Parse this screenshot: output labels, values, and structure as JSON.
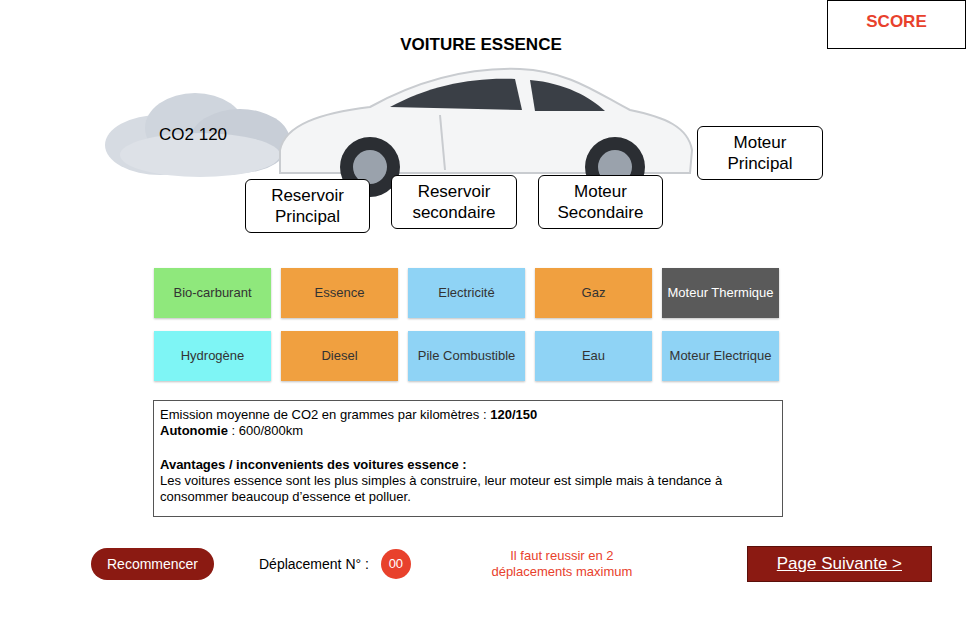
{
  "header": {
    "title": "VOITURE ESSENCE",
    "score_label": "SCORE"
  },
  "car": {
    "emission_label": "CO2 120"
  },
  "drop_zones": [
    {
      "label": "Reservoir Principal"
    },
    {
      "label": "Reservoir secondaire"
    },
    {
      "label": "Moteur Secondaire"
    },
    {
      "label": "Moteur Principal"
    }
  ],
  "tiles": [
    {
      "label": "Bio-carburant",
      "color": "#8fe87c"
    },
    {
      "label": "Essence",
      "color": "#f0a040"
    },
    {
      "label": "Electricité",
      "color": "#8fd3f5"
    },
    {
      "label": "Gaz",
      "color": "#f0a040"
    },
    {
      "label": "Moteur Thermique",
      "color": "#5a5a5a"
    },
    {
      "label": "Hydrogène",
      "color": "#7ef5f5"
    },
    {
      "label": "Diesel",
      "color": "#f0a040"
    },
    {
      "label": "Pile Combustible",
      "color": "#8fd3f5"
    },
    {
      "label": "Eau",
      "color": "#8fd3f5"
    },
    {
      "label": "Moteur Electrique",
      "color": "#8fd3f5"
    }
  ],
  "info": {
    "emission_label": "Emission moyenne de CO2 en grammes par kilomètres :",
    "emission_value": "120/150",
    "autonomy_label": "Autonomie",
    "autonomy_value": ": 600/800km",
    "section_title": "Avantages / inconvenients des voitures essence :",
    "description": "Les voitures essence sont les plus simples à construire, leur moteur est simple mais à tendance à consommer beaucoup d’essence et polluer."
  },
  "footer": {
    "restart": "Recommencer",
    "move_label": "Déplacement N° :",
    "move_count": "00",
    "hint": [
      "Il faut reussir en 2",
      "déplacements maximum"
    ],
    "next": "Page Suivante >"
  }
}
